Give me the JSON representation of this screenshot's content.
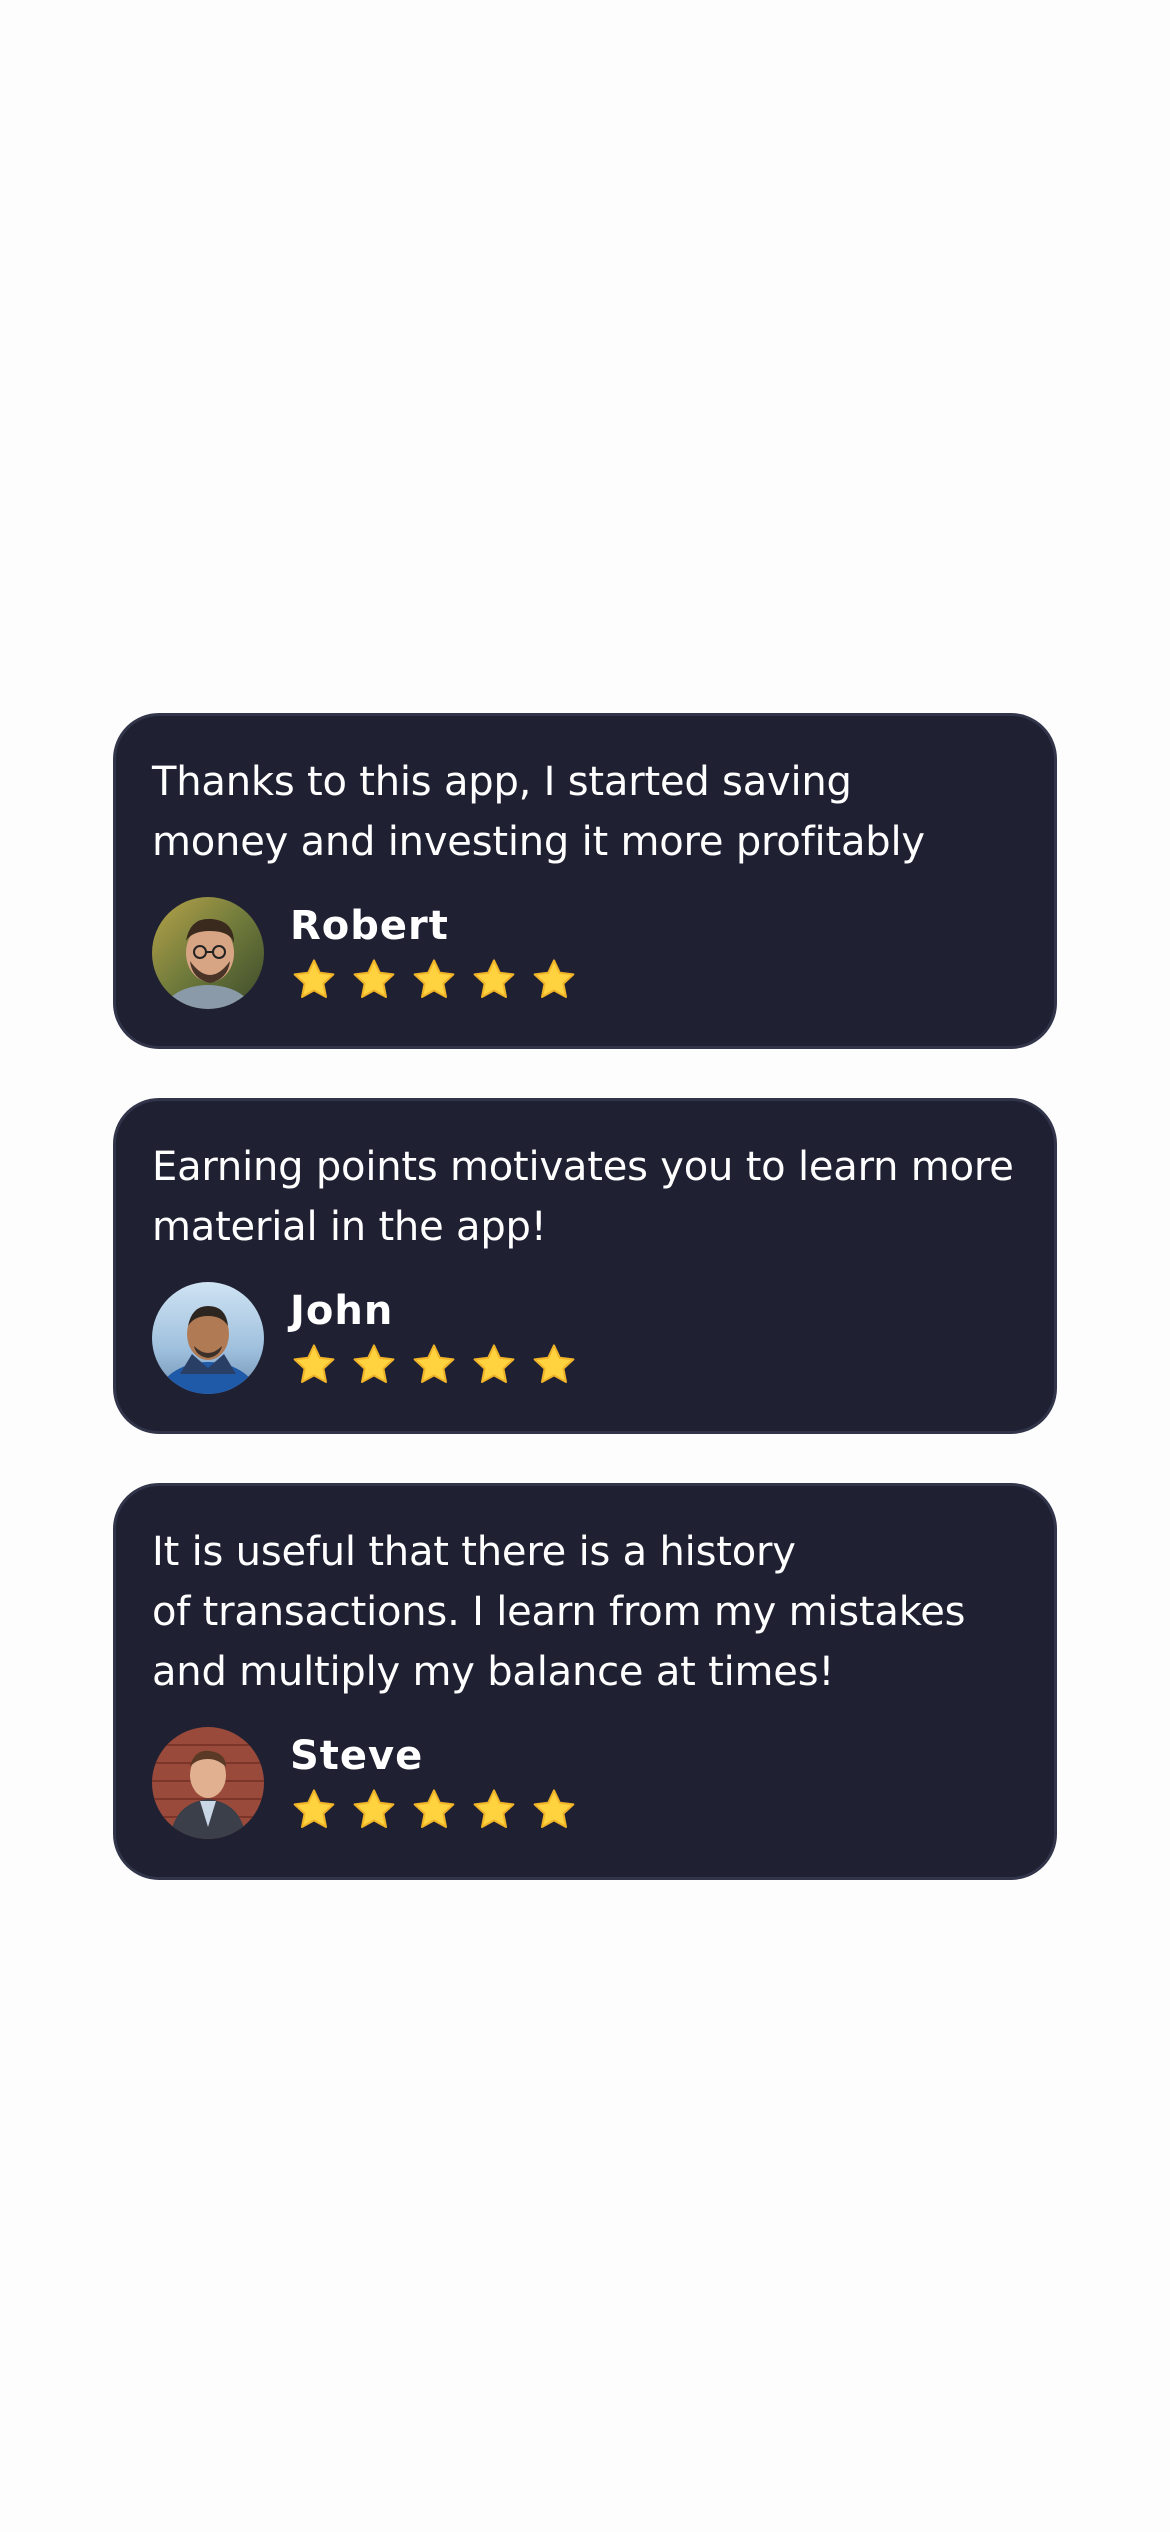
{
  "colors": {
    "background": "#fdfdfd",
    "card": "#1f2133",
    "card_border": "#32354a",
    "text": "#ffffff",
    "star": "#ffd23f"
  },
  "reviews": [
    {
      "quote": "Thanks to this app, I started saving\nmoney and investing it more profitably",
      "author": "Robert",
      "rating": 5,
      "avatar_icon": "robert-avatar-photo"
    },
    {
      "quote": "Earning points motivates you to learn more\nmaterial in the app!",
      "author": "John",
      "rating": 5,
      "avatar_icon": "john-avatar-photo"
    },
    {
      "quote": "It is useful that there is a history\nof transactions. I learn from my mistakes\nand multiply my balance at times!",
      "author": "Steve",
      "rating": 5,
      "avatar_icon": "steve-avatar-photo"
    }
  ]
}
